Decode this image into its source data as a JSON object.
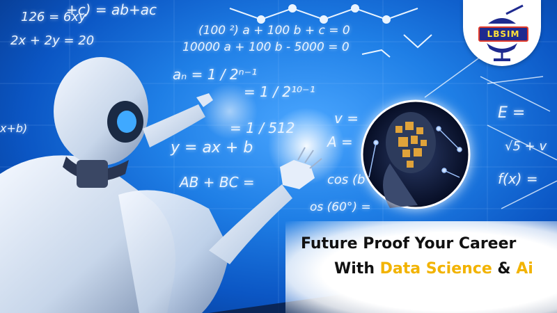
{
  "logo": {
    "text": "LBSIM"
  },
  "board": {
    "equations": [
      "126 = 6xy",
      "2x + 2y = 20",
      "(100 ²) a + 100 b + c = 0",
      "10000 a + 100 b - 5000 = 0",
      "aₙ = 1 / 2ⁿ⁻¹",
      "= 1 / 2¹⁰⁻¹",
      "= 1 / 512",
      "y = ax + b",
      "AB + BC =",
      "cos (b",
      "os (60°) =",
      "E =",
      "√5 + v",
      "f(x) =",
      "v =",
      "A =",
      "x+b)",
      "+c) = ab+ac"
    ]
  },
  "headline": {
    "line1": "Future Proof  Your Career",
    "line2_prefix": "With ",
    "line2_highlight1": "Data Science",
    "line2_mid": " & ",
    "line2_highlight2": "Ai"
  },
  "colors": {
    "background": "#1f7fe6",
    "headline_text": "#111111",
    "headline_highlight": "#f2b300",
    "logo_bg": "#1e2a8f",
    "logo_text": "#ffe23a"
  }
}
